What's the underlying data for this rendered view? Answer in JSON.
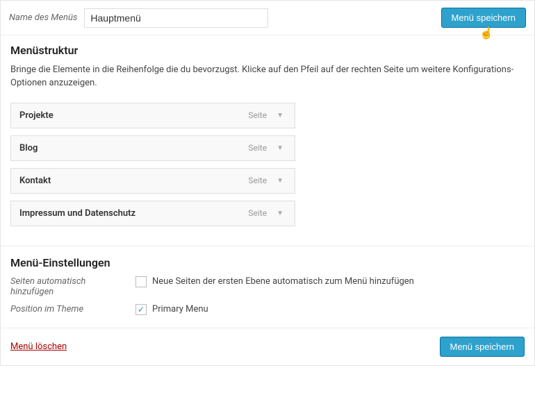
{
  "header": {
    "name_label": "Name des Menüs",
    "name_value": "Hauptmenü",
    "save_label": "Menü speichern"
  },
  "structure": {
    "title": "Menüstruktur",
    "description": "Bringe die Elemente in die Reihenfolge die du bevorzugst. Klicke auf den Pfeil auf der rechten Seite um weitere Konfigurations-Optionen anzuzeigen.",
    "items": [
      {
        "title": "Projekte",
        "type": "Seite"
      },
      {
        "title": "Blog",
        "type": "Seite"
      },
      {
        "title": "Kontakt",
        "type": "Seite"
      },
      {
        "title": "Impressum und Datenschutz",
        "type": "Seite"
      }
    ]
  },
  "settings": {
    "title": "Menü-Einstellungen",
    "auto_add_label": "Seiten automatisch hinzufügen",
    "auto_add_option": "Neue Seiten der ersten Ebene automatisch zum Menü hinzufügen",
    "auto_add_checked": false,
    "theme_location_label": "Position im Theme",
    "theme_location_option": "Primary Menu",
    "theme_location_checked": true
  },
  "footer": {
    "delete_label": "Menü löschen",
    "save_label": "Menü speichern"
  },
  "glyphs": {
    "triangle_down": "▼",
    "check": "✓"
  }
}
